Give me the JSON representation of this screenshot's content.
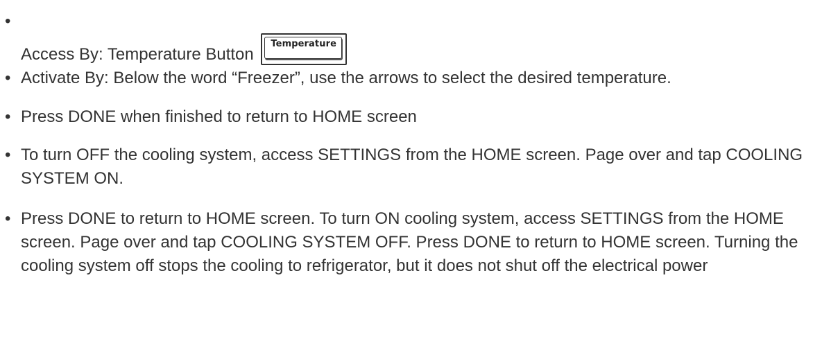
{
  "items": [
    {
      "text": "Access By: Temperature Button",
      "button_label": "Temperature"
    },
    {
      "text": "Activate By: Below the word “Freezer”, use the arrows to select the desired temperature."
    },
    {
      "text": "Press DONE when finished to return to HOME screen"
    },
    {
      "text": "To turn OFF the cooling system, access SETTINGS from the HOME screen. Page over and tap COOLING SYSTEM ON."
    },
    {
      "text": "Press DONE to return to HOME screen. To turn ON cooling system, access SETTINGS from the HOME screen. Page over and tap COOLING SYSTEM OFF. Press DONE to return to HOME screen. Turning the cooling system off stops the cooling to refrigerator, but it does not shut off the electrical power"
    }
  ],
  "bullet_char": "•"
}
